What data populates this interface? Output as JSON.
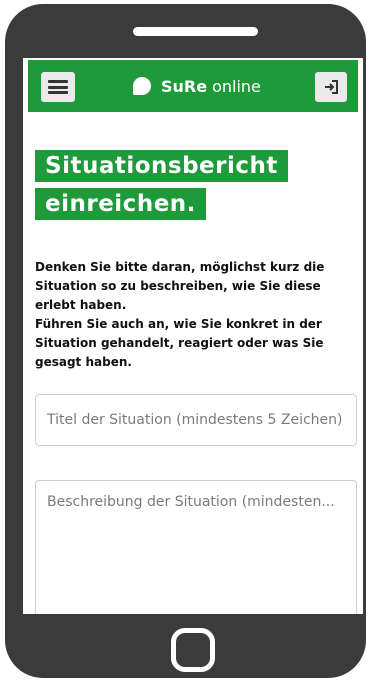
{
  "app": {
    "brand_strong": "SuRe",
    "brand_light": "online"
  },
  "icons": {
    "menu": "hamburger-menu-icon",
    "logout": "logout-icon",
    "brand": "speech-bubble-icon",
    "home": "home-button-icon"
  },
  "colors": {
    "accent": "#1f9a3a",
    "device": "#3b3b3b"
  },
  "page": {
    "heading_line1": "Situationsbericht",
    "heading_line2": "einreichen.",
    "intro_para1": "Denken Sie bitte daran, möglichst kurz die Situation so zu beschreiben, wie Sie diese erlebt haben.",
    "intro_para2": "Führen Sie auch an, wie Sie konkret in der Situation gehandelt, reagiert oder was Sie gesagt haben."
  },
  "form": {
    "title_placeholder": "Titel der Situation (mindestens 5 Zeichen)",
    "description_placeholder": "Beschreibung der Situation (mindesten..."
  }
}
